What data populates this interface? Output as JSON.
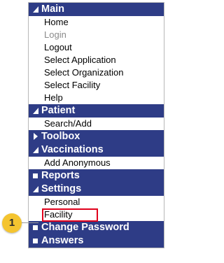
{
  "menu": {
    "main": {
      "header": "Main",
      "items": [
        "Home",
        "Login",
        "Logout",
        "Select Application",
        "Select Organization",
        "Select Facility",
        "Help"
      ]
    },
    "patient": {
      "header": "Patient",
      "items": [
        "Search/Add"
      ]
    },
    "toolbox": {
      "header": "Toolbox"
    },
    "vaccinations": {
      "header": "Vaccinations",
      "items": [
        "Add Anonymous"
      ]
    },
    "reports": {
      "header": "Reports"
    },
    "settings": {
      "header": "Settings",
      "items": [
        "Personal",
        "Facility"
      ]
    },
    "change_password": {
      "header": "Change Password"
    },
    "answers": {
      "header": "Answers"
    }
  },
  "callout": {
    "number": "1"
  },
  "colors": {
    "header_bg": "#2e3c86",
    "highlight": "#e0001b",
    "callout": "#f4c430"
  }
}
